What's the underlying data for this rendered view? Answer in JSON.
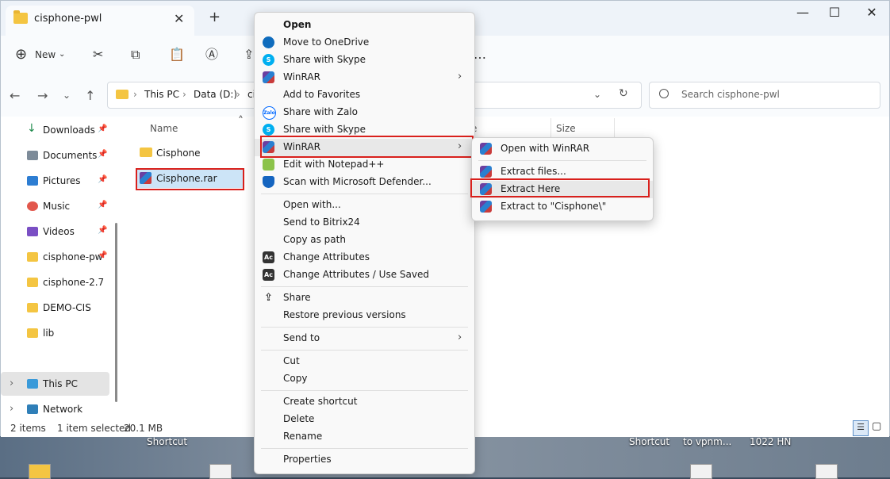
{
  "window": {
    "tab_title": "cisphone-pwl",
    "tab_close": "✕",
    "new_tab": "+",
    "controls": {
      "minimize": "—",
      "maximize": "☐",
      "close": "✕"
    }
  },
  "toolbar": {
    "new_label": "New"
  },
  "address": {
    "crumbs": [
      "This PC",
      "Data (D:)",
      "ci"
    ],
    "separator": "›",
    "refresh": "↻"
  },
  "search": {
    "placeholder": "Search cisphone-pwl"
  },
  "sidebar": {
    "quick": [
      {
        "label": "Downloads",
        "icon": "download-icon",
        "pinned": true
      },
      {
        "label": "Documents",
        "icon": "document-icon",
        "pinned": true
      },
      {
        "label": "Pictures",
        "icon": "picture-icon",
        "pinned": true
      },
      {
        "label": "Music",
        "icon": "music-icon",
        "pinned": true
      },
      {
        "label": "Videos",
        "icon": "video-icon",
        "pinned": true
      },
      {
        "label": "cisphone-pw",
        "icon": "folder-icon",
        "pinned": true
      },
      {
        "label": "cisphone-2.7",
        "icon": "folder-icon",
        "pinned": false
      },
      {
        "label": "DEMO-CIS",
        "icon": "folder-icon",
        "pinned": false
      },
      {
        "label": "lib",
        "icon": "folder-icon",
        "pinned": false
      }
    ],
    "this_pc": "This PC",
    "network": "Network"
  },
  "columns": {
    "name": "Name",
    "type_partial": "e",
    "size": "Size"
  },
  "files": [
    {
      "name": "Cisphone",
      "icon": "folder-icon",
      "selected": false
    },
    {
      "name": "Cisphone.rar",
      "icon": "winrar-icon",
      "selected": true
    }
  ],
  "status": {
    "items": "2 items",
    "selected": "1 item selected",
    "size": "20.1 MB"
  },
  "context_menu": {
    "items": [
      {
        "label": "Open",
        "bold": true
      },
      {
        "label": "Move to OneDrive",
        "icon": "onedrive-icon"
      },
      {
        "label": "Share with Skype",
        "icon": "skype-icon"
      },
      {
        "label": "WinRAR",
        "icon": "winrar-icon",
        "submenu": true
      },
      {
        "label": "Add to Favorites"
      },
      {
        "label": "Share with Zalo",
        "icon": "zalo-icon"
      },
      {
        "label": "Share with Skype",
        "icon": "skype-icon"
      },
      {
        "label": "WinRAR",
        "icon": "winrar-icon",
        "submenu": true,
        "highlighted": true
      },
      {
        "label": "Edit with Notepad++",
        "icon": "notepad-icon"
      },
      {
        "label": "Scan with Microsoft Defender...",
        "icon": "defender-icon"
      },
      {
        "label": "Open with..."
      },
      {
        "label": "Send to Bitrix24"
      },
      {
        "label": "Copy as path"
      },
      {
        "label": "Change Attributes",
        "icon": "attributes-icon"
      },
      {
        "label": "Change Attributes / Use Saved",
        "icon": "attributes-icon"
      },
      {
        "label": "Share",
        "icon": "share-icon"
      },
      {
        "label": "Restore previous versions"
      },
      {
        "label": "Send to",
        "submenu": true
      },
      {
        "label": "Cut"
      },
      {
        "label": "Copy"
      },
      {
        "label": "Create shortcut"
      },
      {
        "label": "Delete"
      },
      {
        "label": "Rename"
      },
      {
        "label": "Properties"
      }
    ],
    "arrow": "›"
  },
  "winrar_submenu": {
    "items": [
      {
        "label": "Open with WinRAR"
      },
      {
        "label": "Extract files..."
      },
      {
        "label": "Extract Here",
        "highlighted": true
      },
      {
        "label": "Extract to \"Cisphone\\\""
      }
    ]
  },
  "desktop": {
    "labels": [
      "Shortcut",
      "Shortcut",
      "to vpnm...",
      "1022 HN"
    ]
  }
}
